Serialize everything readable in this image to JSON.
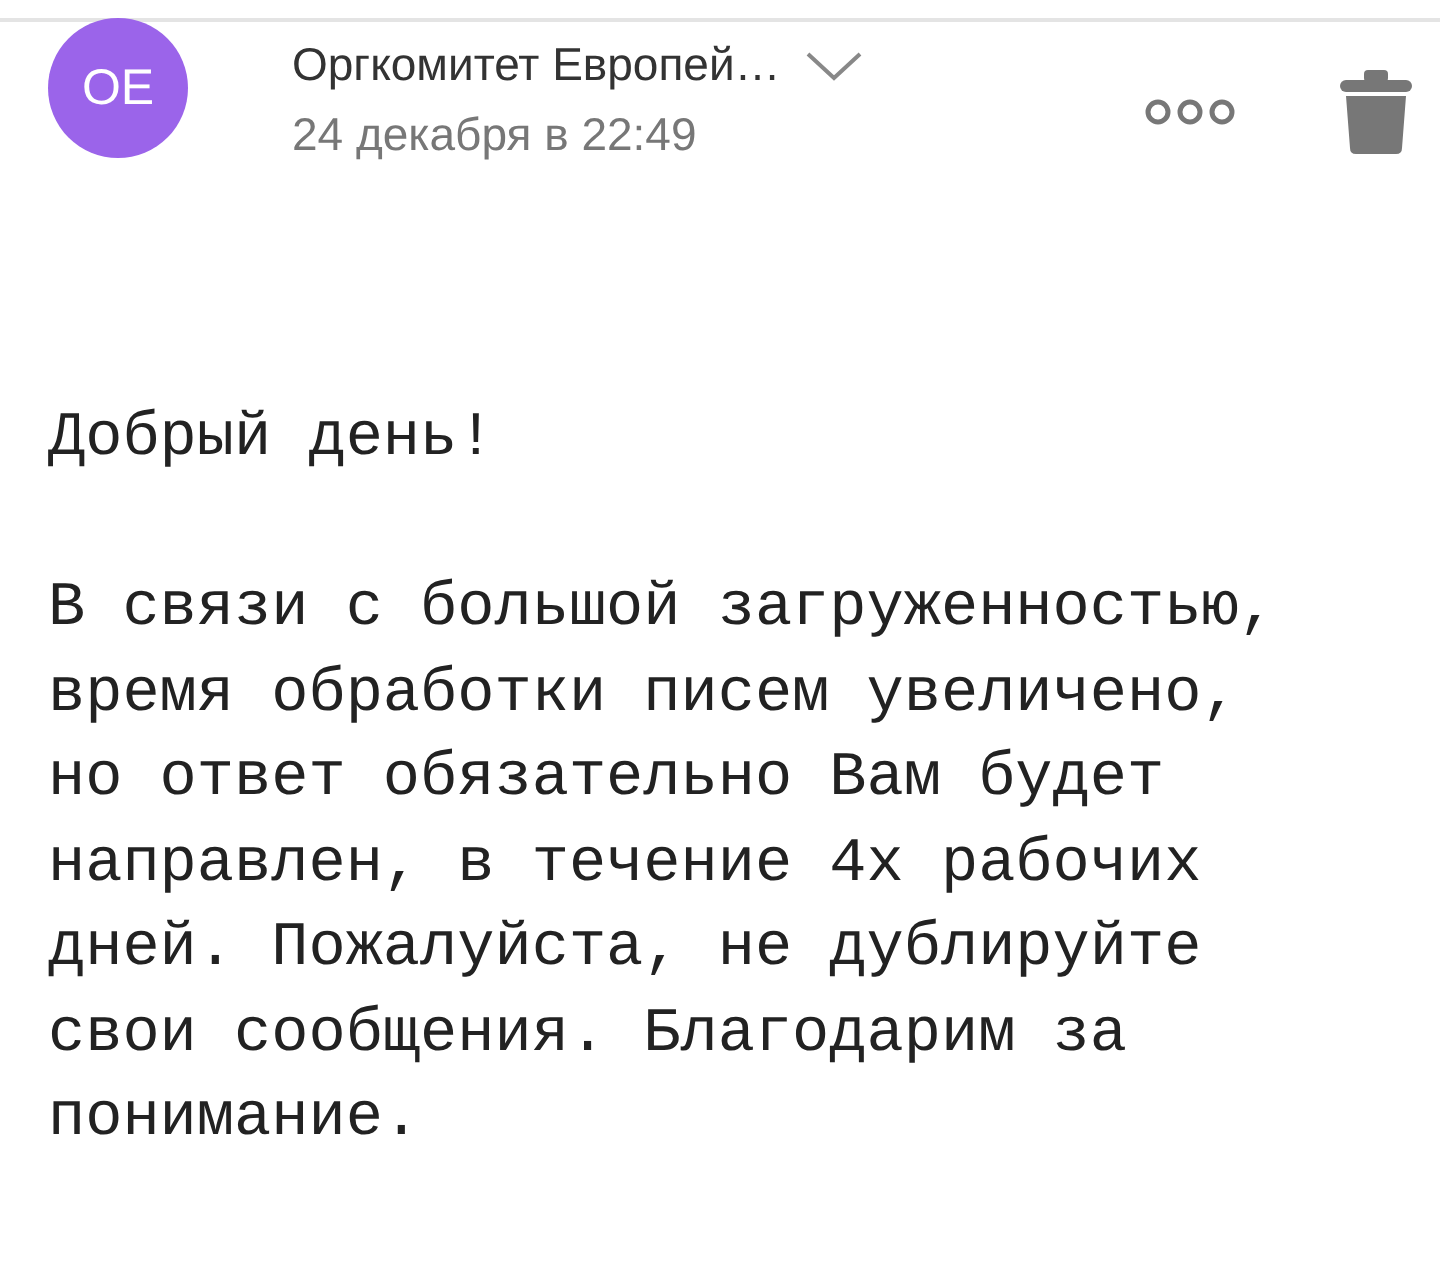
{
  "header": {
    "avatar": {
      "initials": "OE",
      "color": "#9b64ea"
    },
    "sender": "Оргкомитет Европей…",
    "date": "24 декабря в 22:49"
  },
  "body": [
    "Добрый день!",
    "В связи с большой загруженностью,\nвремя обработки писем увеличено,\nно ответ обязательно Вам будет\nнаправлен, в течение 4х рабочих\nдней. Пожалуйста, не дублируйте\nсвои сообщения. Благодарим за\nпонимание."
  ]
}
